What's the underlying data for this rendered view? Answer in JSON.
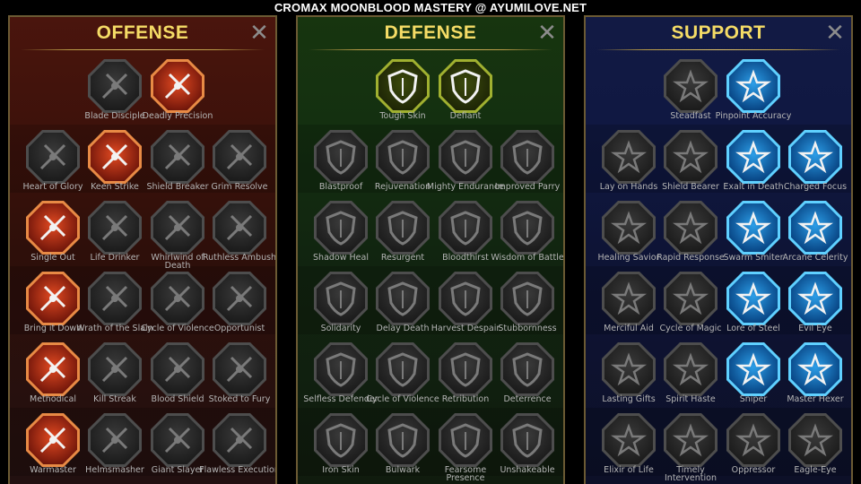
{
  "banner": "CROMAX MOONBLOOD MASTERY @ AYUMILOVE.NET",
  "close_glyph": "✕",
  "panels": {
    "offense": {
      "title": "OFFENSE",
      "skills": [
        {
          "label": "Blade Disciple",
          "icon": "crossed-swords-icon",
          "active": false
        },
        {
          "label": "Deadly Precision",
          "icon": "dagger-strike-icon",
          "active": true
        },
        {
          "label": "Heart of Glory",
          "icon": "horned-warrior-icon",
          "active": false
        },
        {
          "label": "Keen Strike",
          "icon": "claw-slash-icon",
          "active": true
        },
        {
          "label": "Shield Breaker",
          "icon": "broken-shield-icon",
          "active": false
        },
        {
          "label": "Grim Resolve",
          "icon": "winged-heart-icon",
          "active": false
        },
        {
          "label": "Single Out",
          "icon": "target-strike-icon",
          "active": true
        },
        {
          "label": "Life Drinker",
          "icon": "fanged-maw-icon",
          "active": false
        },
        {
          "label": "Whirlwind of Death",
          "icon": "whirlwind-icon",
          "active": false
        },
        {
          "label": "Ruthless Ambush",
          "icon": "ambush-icon",
          "active": false
        },
        {
          "label": "Bring it Down",
          "icon": "downward-sword-icon",
          "active": true
        },
        {
          "label": "Wrath of the Slain",
          "icon": "fist-icon",
          "active": false
        },
        {
          "label": "Cycle of Violence",
          "icon": "axe-icon",
          "active": false
        },
        {
          "label": "Opportunist",
          "icon": "chains-icon",
          "active": false
        },
        {
          "label": "Methodical",
          "icon": "target-arrows-icon",
          "active": true
        },
        {
          "label": "Kill Streak",
          "icon": "skull-icon",
          "active": false
        },
        {
          "label": "Blood Shield",
          "icon": "sword-shield-icon",
          "active": false
        },
        {
          "label": "Stoked to Fury",
          "icon": "fury-figure-icon",
          "active": false
        },
        {
          "label": "Warmaster",
          "icon": "spark-swords-icon",
          "active": true
        },
        {
          "label": "Helmsmasher",
          "icon": "helmet-icon",
          "active": false
        },
        {
          "label": "Giant Slayer",
          "icon": "giant-icon",
          "active": false
        },
        {
          "label": "Flawless Execution",
          "icon": "skull-chains-icon",
          "active": false
        }
      ]
    },
    "defense": {
      "title": "DEFENSE",
      "skills": [
        {
          "label": "Tough Skin",
          "icon": "scales-icon",
          "active": true
        },
        {
          "label": "Defiant",
          "icon": "raised-fist-icon",
          "active": true
        },
        {
          "label": "Blastproof",
          "icon": "chevron-shield-icon",
          "active": false
        },
        {
          "label": "Rejuvenation",
          "icon": "heart-hands-icon",
          "active": false
        },
        {
          "label": "Mighty Endurance",
          "icon": "muscle-icon",
          "active": false
        },
        {
          "label": "Improved Parry",
          "icon": "parry-blades-icon",
          "active": false
        },
        {
          "label": "Shadow Heal",
          "icon": "shadow-figure-icon",
          "active": false
        },
        {
          "label": "Resurgent",
          "icon": "knight-icon",
          "active": false
        },
        {
          "label": "Bloodthirst",
          "icon": "blood-heart-icon",
          "active": false
        },
        {
          "label": "Wisdom of Battle",
          "icon": "spiral-head-icon",
          "active": false
        },
        {
          "label": "Solidarity",
          "icon": "group-icon",
          "active": false
        },
        {
          "label": "Delay Death",
          "icon": "hourglass-icon",
          "active": false
        },
        {
          "label": "Harvest Despair",
          "icon": "open-hand-icon",
          "active": false
        },
        {
          "label": "Stubbornness",
          "icon": "bull-icon",
          "active": false
        },
        {
          "label": "Selfless Defender",
          "icon": "defender-icon",
          "active": false
        },
        {
          "label": "Cycle of Violence",
          "icon": "flames-icon",
          "active": false
        },
        {
          "label": "Retribution",
          "icon": "burning-skull-icon",
          "active": false
        },
        {
          "label": "Deterrence",
          "icon": "deflect-icon",
          "active": false
        },
        {
          "label": "Iron Skin",
          "icon": "armored-figure-icon",
          "active": false
        },
        {
          "label": "Bulwark",
          "icon": "bulwark-shield-icon",
          "active": false
        },
        {
          "label": "Fearsome Presence",
          "icon": "screaming-face-icon",
          "active": false
        },
        {
          "label": "Unshakeable",
          "icon": "strongman-icon",
          "active": false
        }
      ]
    },
    "support": {
      "title": "SUPPORT",
      "skills": [
        {
          "label": "Steadfast",
          "icon": "heart-sparkle-icon",
          "active": false
        },
        {
          "label": "Pinpoint Accuracy",
          "icon": "bullseye-icon",
          "active": true
        },
        {
          "label": "Lay on Hands",
          "icon": "praying-hands-icon",
          "active": false
        },
        {
          "label": "Shield Bearer",
          "icon": "arched-shield-icon",
          "active": false
        },
        {
          "label": "Exalt in Death",
          "icon": "flaming-skull-icon",
          "active": true
        },
        {
          "label": "Charged Focus",
          "icon": "charged-hand-icon",
          "active": true
        },
        {
          "label": "Healing Savior",
          "icon": "healing-figure-icon",
          "active": false
        },
        {
          "label": "Rapid Response",
          "icon": "lightning-shield-icon",
          "active": false
        },
        {
          "label": "Swarm Smiter",
          "icon": "swarm-bolt-icon",
          "active": true
        },
        {
          "label": "Arcane Celerity",
          "icon": "arcane-figures-icon",
          "active": true
        },
        {
          "label": "Merciful Aid",
          "icon": "chained-heart-icon",
          "active": false
        },
        {
          "label": "Cycle of Magic",
          "icon": "meteor-icon",
          "active": false
        },
        {
          "label": "Lore of Steel",
          "icon": "open-book-icon",
          "active": true
        },
        {
          "label": "Evil Eye",
          "icon": "evil-eye-icon",
          "active": true
        },
        {
          "label": "Lasting Gifts",
          "icon": "compass-star-icon",
          "active": false
        },
        {
          "label": "Spirit Haste",
          "icon": "winged-boot-icon",
          "active": false
        },
        {
          "label": "Sniper",
          "icon": "eye-icon",
          "active": true
        },
        {
          "label": "Master Hexer",
          "icon": "hex-figure-icon",
          "active": true
        },
        {
          "label": "Elixir of Life",
          "icon": "potion-icon",
          "active": false
        },
        {
          "label": "Timely Intervention",
          "icon": "horned-skull-icon",
          "active": false
        },
        {
          "label": "Oppressor",
          "icon": "crushing-fist-icon",
          "active": false
        },
        {
          "label": "Eagle-Eye",
          "icon": "eagle-icon",
          "active": false
        }
      ]
    }
  }
}
